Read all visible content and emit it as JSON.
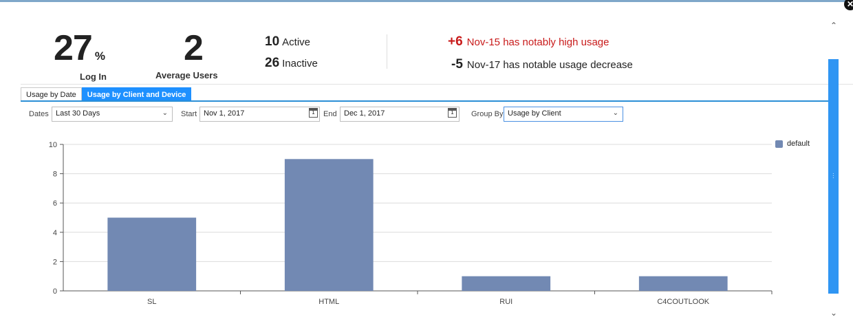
{
  "stats": {
    "login_pct": "27",
    "login_unit": "%",
    "login_label": "Log In",
    "avg_users": "2",
    "avg_users_label": "Average Users",
    "active_count": "10",
    "active_label": "Active",
    "inactive_count": "26",
    "inactive_label": "Inactive"
  },
  "alerts": [
    {
      "delta": "+6",
      "text": "Nov-15 has notably high usage"
    },
    {
      "delta": "-5",
      "text": "Nov-17 has notable usage decrease"
    }
  ],
  "tabs": [
    {
      "label": "Usage by Date"
    },
    {
      "label": "Usage by Client and Device"
    }
  ],
  "filters": {
    "dates_label": "Dates",
    "dates_value": "Last 30 Days",
    "start_label": "Start",
    "start_value": "Nov 1, 2017",
    "end_label": "End",
    "end_value": "Dec 1, 2017",
    "group_label": "Group By",
    "group_value": "Usage by Client",
    "calendar_glyph": "1"
  },
  "icons": {
    "close": "close-icon",
    "chevron": "chevron-down-icon",
    "calendar": "calendar-icon",
    "scroll_up": "chevron-up-icon",
    "scroll_down": "chevron-down-icon"
  },
  "colors": {
    "accent": "#1e90ff",
    "alert_high": "#c81a1a",
    "bar": "#7289b3",
    "scroll_thumb": "#2f95f3"
  },
  "chart_data": {
    "type": "bar",
    "categories": [
      "SL",
      "HTML",
      "RUI",
      "C4COUTLOOK"
    ],
    "series": [
      {
        "name": "default",
        "values": [
          5,
          9,
          1,
          1
        ]
      }
    ],
    "ylim": [
      0,
      10
    ],
    "yticks": [
      0,
      2,
      4,
      6,
      8,
      10
    ],
    "grid": true,
    "legend": "top-right"
  }
}
